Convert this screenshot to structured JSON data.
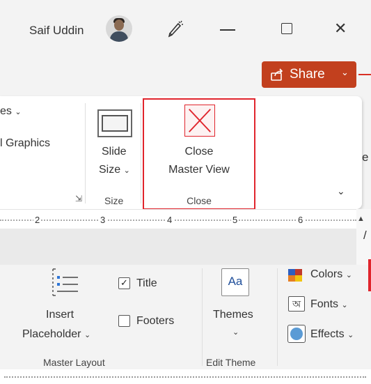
{
  "titlebar": {
    "user_name": "Saif Uddin",
    "share_label": "Share",
    "icons": [
      "avatar",
      "pen-icon",
      "minimize-icon",
      "maximize-icon",
      "close-window-icon"
    ]
  },
  "ribbon": {
    "partial_top_label": "es",
    "partial_graphics_label": "l Graphics",
    "slide_size_line1": "Slide",
    "slide_size_line2": "Size",
    "size_group_label": "Size",
    "close_master_line1": "Close",
    "close_master_line2": "Master View",
    "close_group_label": "Close",
    "partial_right_letter": "e"
  },
  "ruler": {
    "numbers": [
      "2",
      "3",
      "4",
      "5",
      "6"
    ]
  },
  "master_layout": {
    "insert_line1": "Insert",
    "insert_line2": "Placeholder",
    "title_label": "Title",
    "title_checked": true,
    "footers_label": "Footers",
    "footers_checked": false,
    "group_label": "Master Layout"
  },
  "edit_theme": {
    "themes_label": "Themes",
    "themes_icon_text": "Aa",
    "colors_label": "Colors",
    "fonts_label": "Fonts",
    "fonts_icon_text": "অ",
    "effects_label": "Effects",
    "group_label": "Edit Theme"
  },
  "colors": {
    "share_bg": "#c2401e",
    "highlight_border": "#e0242c",
    "ribbon_bg": "#ffffff",
    "window_bg": "#f3f3f3"
  }
}
